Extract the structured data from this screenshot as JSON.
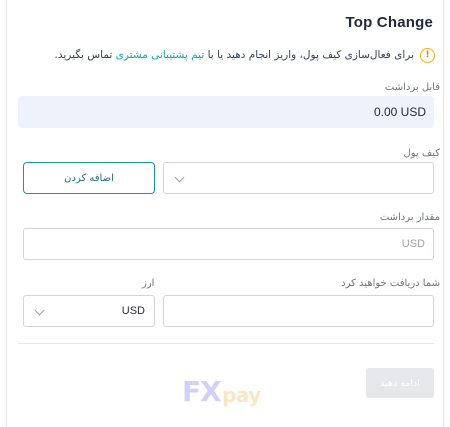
{
  "header": {
    "title": "Top Change"
  },
  "notice": {
    "icon": "exclamation-icon",
    "text_before": "برای فعال‌سازی کیف پول، واریز انجام دهید یا با",
    "link": "تیم پشتیبانی مشتری",
    "text_after": "تماس بگیرید."
  },
  "balance": {
    "label": "قابل برداشت",
    "value": "0.00 USD"
  },
  "wallet": {
    "label": "کیف پول",
    "add_button": "اضافه کردن"
  },
  "amount": {
    "label": "مقدار برداشت",
    "placeholder": "USD"
  },
  "receive": {
    "label": "شما دریافت خواهید کرد"
  },
  "currency": {
    "label": "ارز",
    "value": "USD"
  },
  "actions": {
    "continue": "ادامه دهید"
  },
  "watermark": {
    "part1": "FX",
    "part2": "pay"
  },
  "colors": {
    "accent": "#1497a9",
    "link": "#0ea5b7",
    "warning": "#eab308",
    "balance_bg": "#eef3fb"
  }
}
